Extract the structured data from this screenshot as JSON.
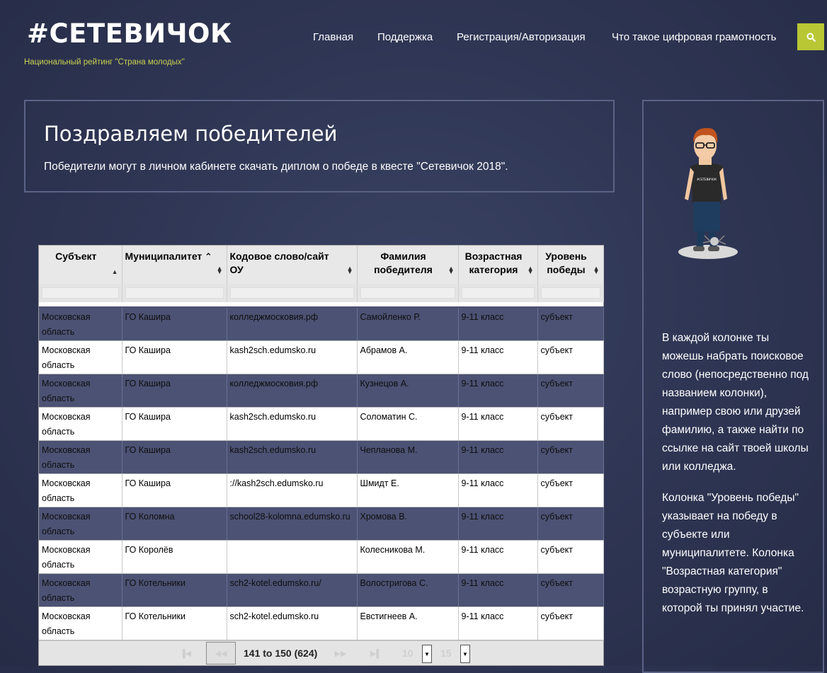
{
  "header": {
    "logo": "#СЕТЕВИЧОК",
    "tagline": "Национальный рейтинг \"Страна молодых\"",
    "nav": [
      {
        "label": "Главная"
      },
      {
        "label": "Поддержка"
      },
      {
        "label": "Регистрация/Авторизация"
      },
      {
        "label": "Что такое цифровая грамотность"
      }
    ],
    "search_icon": "search-icon",
    "accent": "#b9c735"
  },
  "congrats": {
    "title": "Поздравляем победителей",
    "text": "Победители могут в личном кабинете скачать диплом о победе в квесте \"Сетевичок 2018\"."
  },
  "table": {
    "columns": [
      "Субъект",
      "Муниципалитет",
      "Кодовое слово/сайт ОУ",
      "Фамилия победителя",
      "Возрастная категория",
      "Уровень победы"
    ],
    "sorted_column": "Муниципалитет",
    "rows": [
      [
        "Московская область",
        "ГО Кашира",
        "колледжмосковия.рф",
        "Самойленко Р.",
        "9-11 класс",
        "субъект"
      ],
      [
        "Московская область",
        "ГО Кашира",
        "kash2sch.edumsko.ru",
        "Абрамов А.",
        "9-11 класс",
        "субъект"
      ],
      [
        "Московская область",
        "ГО Кашира",
        "колледжмосковия.рф",
        "Кузнецов А.",
        "9-11 класс",
        "субъект"
      ],
      [
        "Московская область",
        "ГО Кашира",
        "kash2sch.edumsko.ru",
        "Соломатин С.",
        "9-11 класс",
        "субъект"
      ],
      [
        "Московская область",
        "ГО Кашира",
        "kash2sch.edumsko.ru",
        "Чепланова М.",
        "9-11 класс",
        "субъект"
      ],
      [
        "Московская область",
        "ГО Кашира",
        "://kash2sch.edumsko.ru",
        "Шмидт Е.",
        "9-11 класс",
        "субъект"
      ],
      [
        "Московская область",
        "ГО Коломна",
        "school28-kolomna.edumsko.ru",
        "Хромова В.",
        "9-11 класс",
        "субъект"
      ],
      [
        "Московская область",
        "ГО Королёв",
        "",
        "Колесникова М.",
        "9-11 класс",
        "субъект"
      ],
      [
        "Московская область",
        "ГО Котельники",
        "sch2-kotel.edumsko.ru/",
        "Волостригова С.",
        "9-11 класс",
        "субъект"
      ],
      [
        "Московская область",
        "ГО Котельники",
        "sch2-kotel.edumsko.ru",
        "Евстигнеев А.",
        "9-11 класс",
        "субъект"
      ]
    ],
    "pager": {
      "info": "141 to 150 (624)",
      "page_size_1": "10",
      "page_size_2": "15"
    }
  },
  "sidebar": {
    "mascot_label": "#СЕТЕВИЧОК",
    "paragraphs": [
      "В каждой колонке ты можешь набрать поисковое слово (непосредственно под названием колонки), например свою или друзей фамилию, а также найти по ссылке на сайт твоей школы или колледжа.",
      "Колонка \"Уровень победы\" указывает на победу в субъекте или муниципалитете.  Колонка \"Возрастная категория\" возрастную группу, в которой ты принял участие."
    ]
  }
}
